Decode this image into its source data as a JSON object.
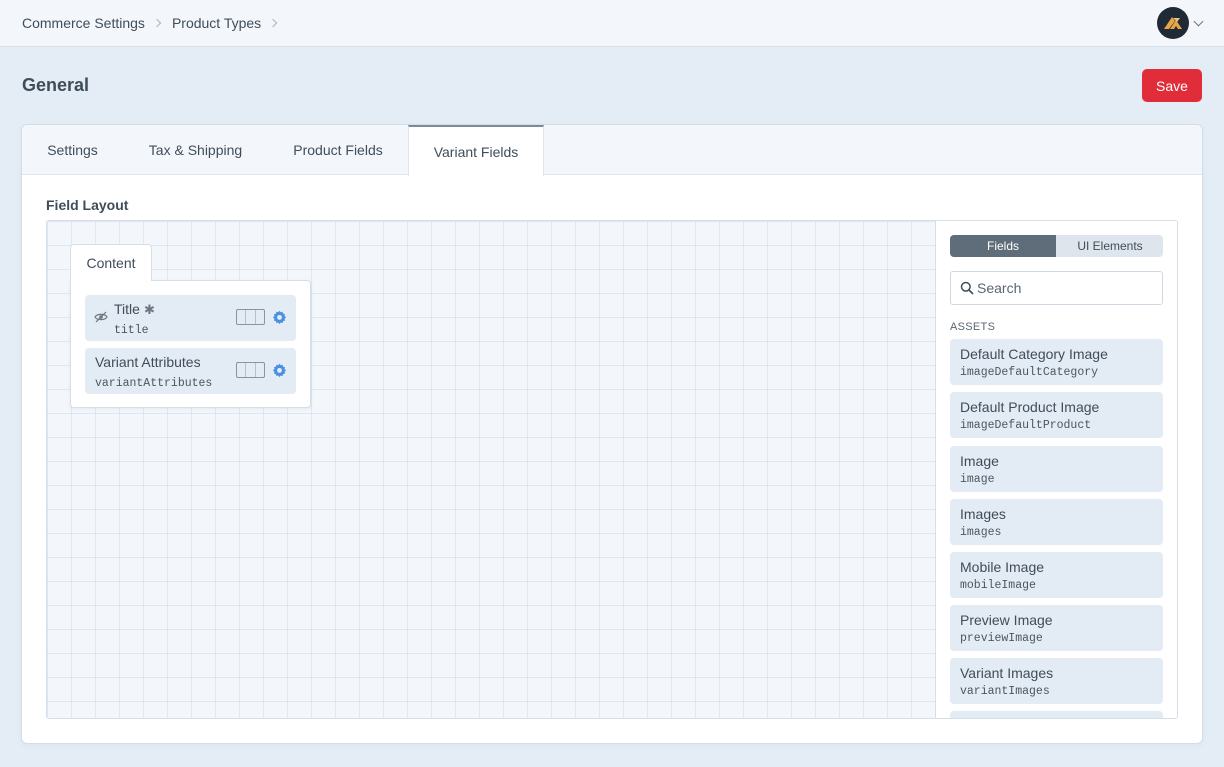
{
  "breadcrumb": [
    {
      "label": "Commerce Settings"
    },
    {
      "label": "Product Types"
    }
  ],
  "header": {
    "avatar_icon": "craft-logo-icon"
  },
  "page": {
    "title": "General",
    "save_label": "Save",
    "accent": "#e12d39"
  },
  "tabs": [
    {
      "label": "Settings",
      "active": false
    },
    {
      "label": "Tax & Shipping",
      "active": false
    },
    {
      "label": "Product Fields",
      "active": false
    },
    {
      "label": "Variant Fields",
      "active": true
    }
  ],
  "field_layout": {
    "label": "Field Layout",
    "tab_name": "Content",
    "fields": [
      {
        "name": "Title",
        "handle": "title",
        "required": true,
        "hidden_icon": "eye-slash-icon"
      },
      {
        "name": "Variant Attributes",
        "handle": "variantAttributes",
        "required": false
      }
    ]
  },
  "library": {
    "toggle": {
      "fields": "Fields",
      "ui_elements": "UI Elements",
      "selected": "Fields"
    },
    "search_placeholder": "Search",
    "group": "ASSETS",
    "items": [
      {
        "name": "Default Category Image",
        "handle": "imageDefaultCategory"
      },
      {
        "name": "Default Product Image",
        "handle": "imageDefaultProduct"
      },
      {
        "name": "Image",
        "handle": "image"
      },
      {
        "name": "Images",
        "handle": "images"
      },
      {
        "name": "Mobile Image",
        "handle": "mobileImage"
      },
      {
        "name": "Preview Image",
        "handle": "previewImage"
      },
      {
        "name": "Variant Images",
        "handle": "variantImages"
      }
    ]
  }
}
